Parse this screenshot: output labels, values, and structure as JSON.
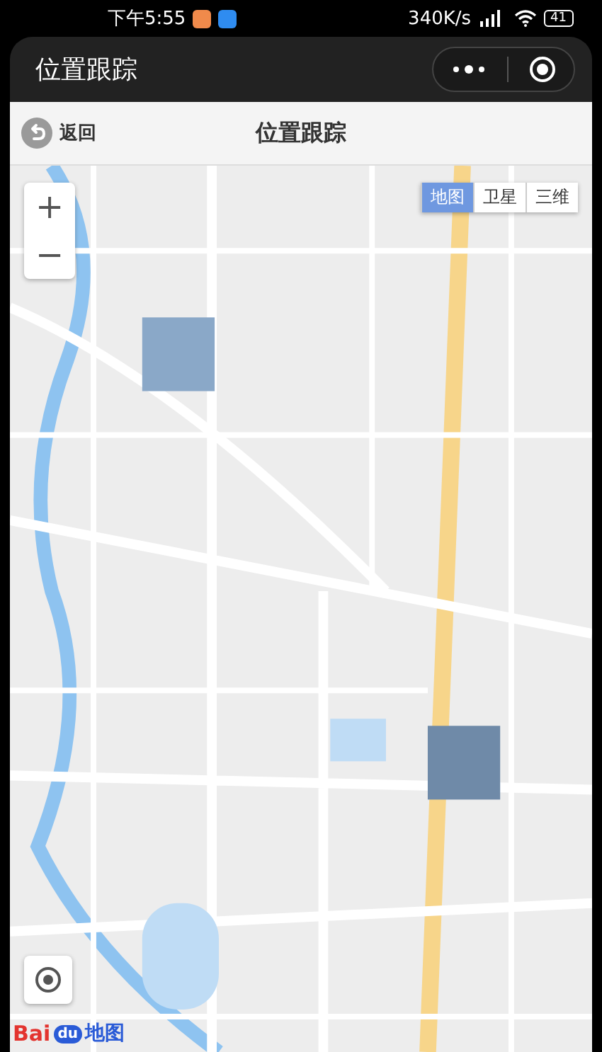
{
  "status_bar": {
    "time": "下午5:55",
    "speed": "340K/s",
    "battery": "41"
  },
  "window": {
    "title": "位置跟踪"
  },
  "header": {
    "back": "返回",
    "title": "位置跟踪"
  },
  "map": {
    "types": [
      {
        "label": "地图",
        "selected": true
      },
      {
        "label": "卫星",
        "selected": false
      },
      {
        "label": "三维",
        "selected": false
      }
    ],
    "zoom_in": "+",
    "zoom_out": "−",
    "logo": {
      "part_1": "Bai",
      "part_2": "du",
      "part_3": "地图"
    }
  }
}
